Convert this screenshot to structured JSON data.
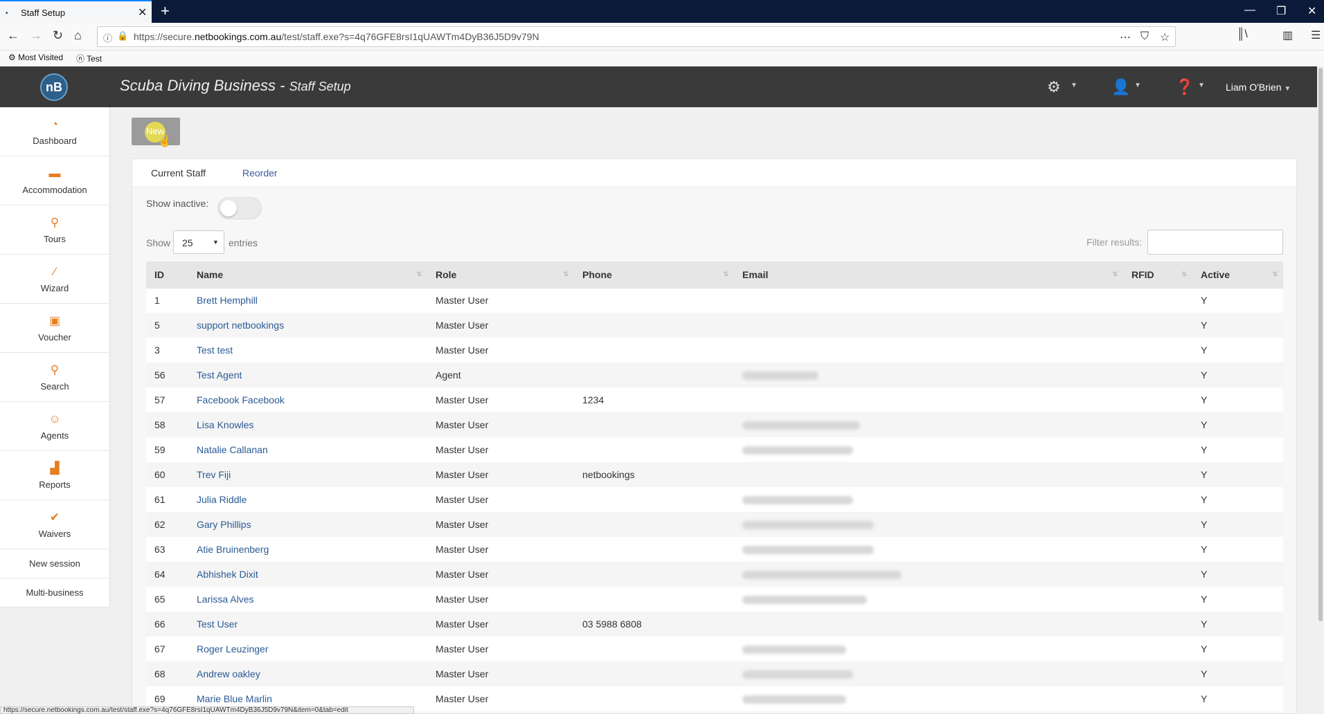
{
  "browser": {
    "tab_title": "Staff Setup",
    "tab_dot": "•",
    "tab_close": "✕",
    "new_tab": "+",
    "url_host_prefix": "https://secure.",
    "url_host_main": "netbookings.com.au",
    "url_path": "/test/staff.exe?s=4q76GFE8rsI1qUAWTm4DyB36J5D9v79N",
    "bookmarks": [
      {
        "label": "Most Visited"
      },
      {
        "label": "Test"
      }
    ],
    "status_url": "https://secure.netbookings.com.au/test/staff.exe?s=4q76GFE8rsI1qUAWTm4DyB36J5D9v79N&item=0&tab=edit"
  },
  "header": {
    "logo_text": "nB",
    "business_name": "Scuba Diving Business",
    "separator": " - ",
    "page_name": "Staff Setup",
    "user_name": "Liam O'Brien"
  },
  "sidebar": {
    "items": [
      {
        "label": "Dashboard",
        "icon": "dashboard-icon"
      },
      {
        "label": "Accommodation",
        "icon": "bed-icon"
      },
      {
        "label": "Tours",
        "icon": "tours-icon"
      },
      {
        "label": "Wizard",
        "icon": "wand-icon"
      },
      {
        "label": "Voucher",
        "icon": "gift-icon"
      },
      {
        "label": "Search",
        "icon": "search-icon"
      },
      {
        "label": "Agents",
        "icon": "agent-icon"
      },
      {
        "label": "Reports",
        "icon": "chart-icon"
      },
      {
        "label": "Waivers",
        "icon": "check-icon"
      }
    ],
    "new_session": "New session",
    "multi_business": "Multi-business"
  },
  "toolbar": {
    "new_label": "New"
  },
  "tabs": {
    "current_staff": "Current Staff",
    "reorder": "Reorder"
  },
  "filters": {
    "show_inactive_label": "Show inactive:",
    "show_label": "Show",
    "entries_value": "25",
    "entries_label": "entries",
    "filter_label": "Filter results:"
  },
  "table": {
    "columns": [
      "ID",
      "Name",
      "Role",
      "Phone",
      "Email",
      "RFID",
      "Active"
    ],
    "rows": [
      {
        "id": "1",
        "name": "Brett Hemphill",
        "role": "Master User",
        "phone": "",
        "email_blur": 0,
        "active": "Y"
      },
      {
        "id": "5",
        "name": "support netbookings",
        "role": "Master User",
        "phone": "",
        "email_blur": 0,
        "active": "Y"
      },
      {
        "id": "3",
        "name": "Test test",
        "role": "Master User",
        "phone": "",
        "email_blur": 0,
        "active": "Y"
      },
      {
        "id": "56",
        "name": "Test Agent",
        "role": "Agent",
        "phone": "",
        "email_blur": 110,
        "active": "Y"
      },
      {
        "id": "57",
        "name": "Facebook Facebook",
        "role": "Master User",
        "phone": "1234",
        "email_blur": 0,
        "active": "Y"
      },
      {
        "id": "58",
        "name": "Lisa Knowles",
        "role": "Master User",
        "phone": "",
        "email_blur": 170,
        "active": "Y"
      },
      {
        "id": "59",
        "name": "Natalie Callanan",
        "role": "Master User",
        "phone": "",
        "email_blur": 160,
        "active": "Y"
      },
      {
        "id": "60",
        "name": "Trev Fiji",
        "role": "Master User",
        "phone": "netbookings",
        "email_blur": 0,
        "active": "Y"
      },
      {
        "id": "61",
        "name": "Julia Riddle",
        "role": "Master User",
        "phone": "",
        "email_blur": 160,
        "active": "Y"
      },
      {
        "id": "62",
        "name": "Gary Phillips",
        "role": "Master User",
        "phone": "",
        "email_blur": 190,
        "active": "Y"
      },
      {
        "id": "63",
        "name": "Atie Bruinenberg",
        "role": "Master User",
        "phone": "",
        "email_blur": 190,
        "active": "Y"
      },
      {
        "id": "64",
        "name": "Abhishek Dixit",
        "role": "Master User",
        "phone": "",
        "email_blur": 230,
        "active": "Y"
      },
      {
        "id": "65",
        "name": "Larissa Alves",
        "role": "Master User",
        "phone": "",
        "email_blur": 180,
        "active": "Y"
      },
      {
        "id": "66",
        "name": "Test User",
        "role": "Master User",
        "phone": "03 5988 6808",
        "email_blur": 0,
        "active": "Y"
      },
      {
        "id": "67",
        "name": "Roger Leuzinger",
        "role": "Master User",
        "phone": "",
        "email_blur": 150,
        "active": "Y"
      },
      {
        "id": "68",
        "name": "Andrew oakley",
        "role": "Master User",
        "phone": "",
        "email_blur": 160,
        "active": "Y"
      },
      {
        "id": "69",
        "name": "Marie Blue Marlin",
        "role": "Master User",
        "phone": "",
        "email_blur": 150,
        "active": "Y"
      }
    ]
  },
  "colors": {
    "accent": "#e67e22",
    "link": "#2a5a96",
    "header_bg": "#3a3a3a"
  }
}
